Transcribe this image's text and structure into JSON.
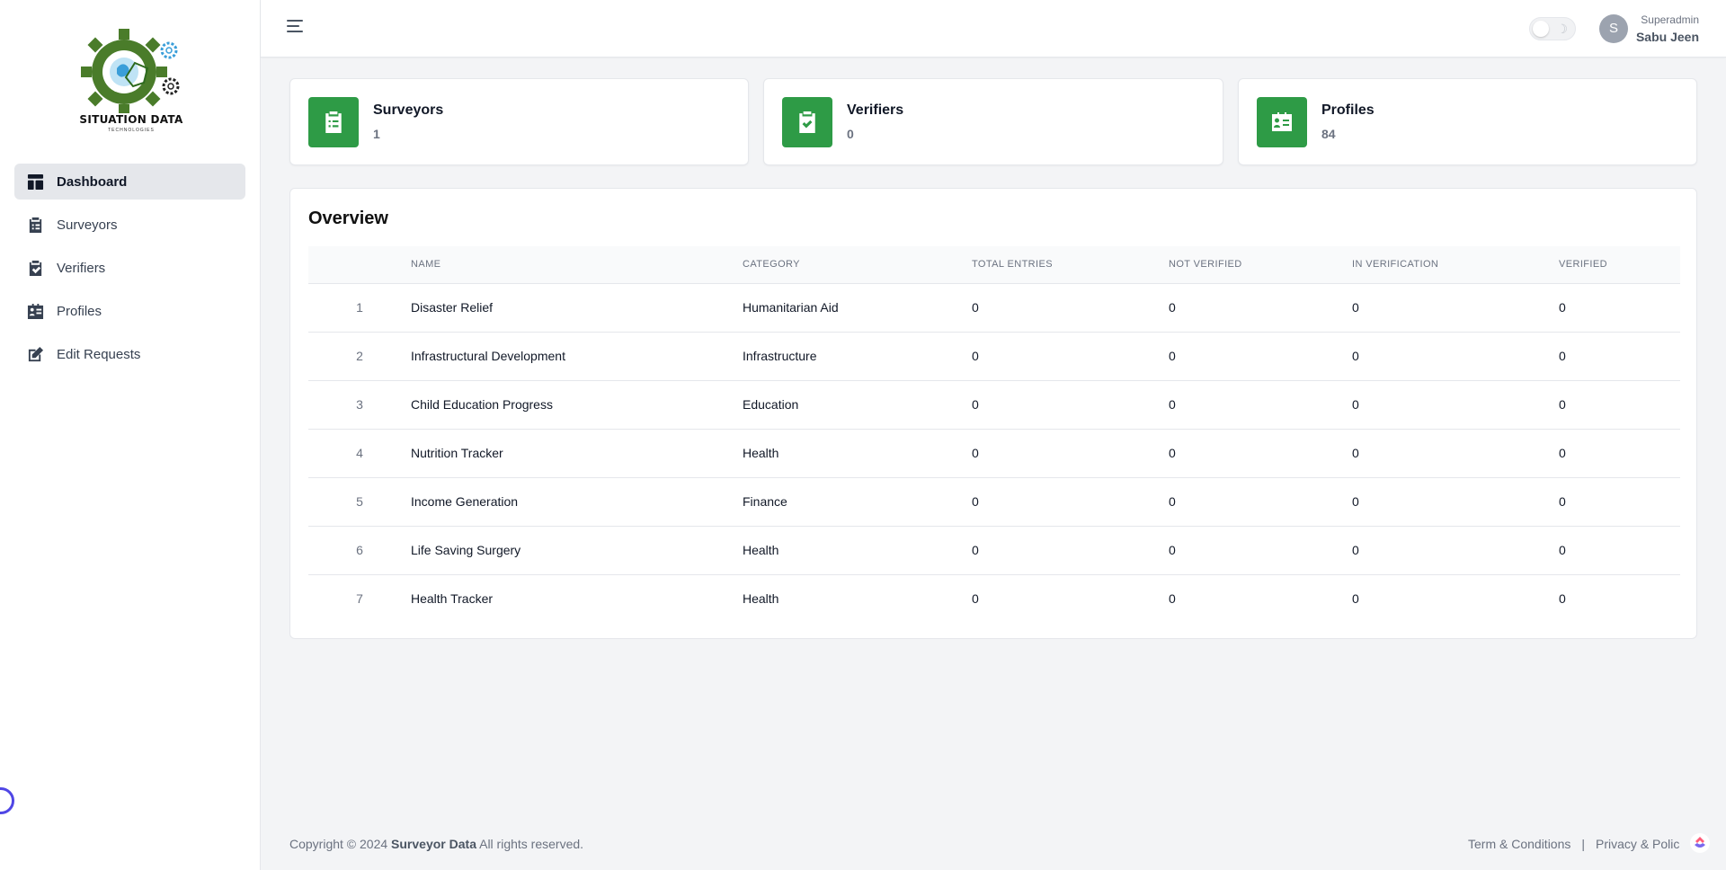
{
  "sidebar": {
    "logo_text": "SITUATION DATA",
    "logo_subtext": "TECHNOLOGIES",
    "items": [
      {
        "label": "Dashboard",
        "icon": "dashboard-icon",
        "active": true
      },
      {
        "label": "Surveyors",
        "icon": "clipboard-list-icon"
      },
      {
        "label": "Verifiers",
        "icon": "clipboard-check-icon"
      },
      {
        "label": "Profiles",
        "icon": "id-card-icon"
      },
      {
        "label": "Edit Requests",
        "icon": "edit-icon"
      }
    ]
  },
  "header": {
    "user_initial": "S",
    "user_role": "Superadmin",
    "user_name": "Sabu Jeen"
  },
  "stats": [
    {
      "title": "Surveyors",
      "value": "1",
      "icon": "clipboard-list-icon"
    },
    {
      "title": "Verifiers",
      "value": "0",
      "icon": "clipboard-check-icon"
    },
    {
      "title": "Profiles",
      "value": "84",
      "icon": "id-card-icon"
    }
  ],
  "overview": {
    "title": "Overview",
    "columns": [
      "",
      "NAME",
      "CATEGORY",
      "TOTAL ENTRIES",
      "NOT VERIFIED",
      "IN VERIFICATION",
      "VERIFIED"
    ],
    "rows": [
      [
        "1",
        "Disaster Relief",
        "Humanitarian Aid",
        "0",
        "0",
        "0",
        "0"
      ],
      [
        "2",
        "Infrastructural Development",
        "Infrastructure",
        "0",
        "0",
        "0",
        "0"
      ],
      [
        "3",
        "Child Education Progress",
        "Education",
        "0",
        "0",
        "0",
        "0"
      ],
      [
        "4",
        "Nutrition Tracker",
        "Health",
        "0",
        "0",
        "0",
        "0"
      ],
      [
        "5",
        "Income Generation",
        "Finance",
        "0",
        "0",
        "0",
        "0"
      ],
      [
        "6",
        "Life Saving Surgery",
        "Health",
        "0",
        "0",
        "0",
        "0"
      ],
      [
        "7",
        "Health Tracker",
        "Health",
        "0",
        "0",
        "0",
        "0"
      ]
    ]
  },
  "footer": {
    "copyright_prefix": "Copyright © 2024",
    "brand": "Surveyor Data",
    "copyright_suffix": "All rights reserved.",
    "terms": "Term & Conditions",
    "separator": "|",
    "privacy": "Privacy & Polic"
  },
  "colors": {
    "accent_green": "#2e9b46",
    "logo_green": "#4a7c2a",
    "float_button": "#4f46e5"
  }
}
